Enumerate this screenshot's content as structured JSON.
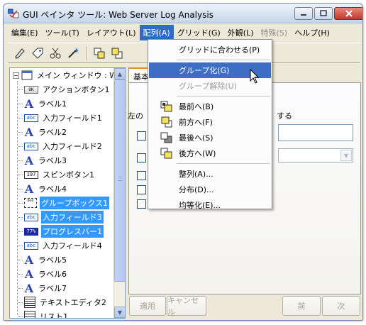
{
  "window": {
    "title": "GUI ペインタ ツール: Web Server Log Analysis"
  },
  "menubar": [
    {
      "label": "編集(E)",
      "active": false,
      "disabled": false
    },
    {
      "label": "ツール(T)",
      "active": false,
      "disabled": false
    },
    {
      "label": "レイアウト(L)",
      "active": false,
      "disabled": false
    },
    {
      "label": "配列(A)",
      "active": true,
      "disabled": false
    },
    {
      "label": "グリッド(G)",
      "active": false,
      "disabled": false
    },
    {
      "label": "外観(L)",
      "active": false,
      "disabled": false
    },
    {
      "label": "特殊(S)",
      "active": false,
      "disabled": true
    },
    {
      "label": "ヘルプ(H)",
      "active": false,
      "disabled": false
    }
  ],
  "toolbar": {
    "icons": [
      "pointer-tool-icon",
      "tag-tool-icon",
      "cut-tool-icon",
      "wand-tool-icon",
      "bring-front-icon",
      "bring-forward-icon"
    ]
  },
  "tree": {
    "root_label": "メイン ウィンドウ : W",
    "items": [
      {
        "label": "アクションボタン1",
        "icon": "button-icon",
        "icon_text": "OK",
        "selected": false
      },
      {
        "label": "ラベル1",
        "icon": "label-icon",
        "icon_text": "A",
        "selected": false
      },
      {
        "label": "入力フィールド1",
        "icon": "input-field-icon",
        "icon_text": "abc",
        "selected": false
      },
      {
        "label": "ラベル2",
        "icon": "label-icon",
        "icon_text": "A",
        "selected": false
      },
      {
        "label": "入力フィールド2",
        "icon": "input-field-icon",
        "icon_text": "abc",
        "selected": false
      },
      {
        "label": "ラベル3",
        "icon": "label-icon",
        "icon_text": "A",
        "selected": false
      },
      {
        "label": "スピンボタン1",
        "icon": "spin-button-icon",
        "icon_text": "197",
        "selected": false
      },
      {
        "label": "ラベル4",
        "icon": "label-icon",
        "icon_text": "A",
        "selected": false
      },
      {
        "label": "グループボックス1",
        "icon": "group-box-icon",
        "icon_text": "box",
        "selected": true
      },
      {
        "label": "入力フィールド3",
        "icon": "input-field-icon",
        "icon_text": "abc",
        "selected": true
      },
      {
        "label": "プログレスバー1",
        "icon": "progress-bar-icon",
        "icon_text": "77%",
        "selected": true
      },
      {
        "label": "入力フィールド4",
        "icon": "input-field-icon",
        "icon_text": "abc",
        "selected": false
      },
      {
        "label": "ラベル5",
        "icon": "label-icon",
        "icon_text": "A",
        "selected": false
      },
      {
        "label": "ラベル6",
        "icon": "label-icon",
        "icon_text": "A",
        "selected": false
      },
      {
        "label": "ラベル7",
        "icon": "label-icon",
        "icon_text": "A",
        "selected": false
      },
      {
        "label": "テキストエディタ2",
        "icon": "text-editor-icon",
        "icon_text": "",
        "selected": false
      },
      {
        "label": "リスト1",
        "icon": "list-icon",
        "icon_text": "",
        "selected": false
      }
    ]
  },
  "panel": {
    "tab_label": "基本",
    "left_label": "左の",
    "right_label": "する",
    "buttons": {
      "apply": "適用",
      "cancel": "キャンセル",
      "prev": "前",
      "next": "次"
    }
  },
  "dropdown": {
    "items": [
      {
        "label": "グリッドに合わせる(P)",
        "icon": "",
        "highlighted": false,
        "disabled": false,
        "sep_after": true
      },
      {
        "label": "グループ化(G)",
        "icon": "",
        "highlighted": true,
        "disabled": false,
        "sep_after": false
      },
      {
        "label": "グループ解除(U)",
        "icon": "",
        "highlighted": false,
        "disabled": true,
        "sep_after": true
      },
      {
        "label": "最前へ(B)",
        "icon": "bring-to-front-icon",
        "highlighted": false,
        "disabled": false,
        "sep_after": false
      },
      {
        "label": "前方へ(F)",
        "icon": "bring-forward-icon",
        "highlighted": false,
        "disabled": false,
        "sep_after": false
      },
      {
        "label": "最後へ(S)",
        "icon": "send-to-back-icon",
        "highlighted": false,
        "disabled": false,
        "sep_after": false
      },
      {
        "label": "後方へ(W)",
        "icon": "send-backward-icon",
        "highlighted": false,
        "disabled": false,
        "sep_after": true
      },
      {
        "label": "整列(A)...",
        "icon": "",
        "highlighted": false,
        "disabled": false,
        "sep_after": false
      },
      {
        "label": "分布(D)...",
        "icon": "",
        "highlighted": false,
        "disabled": false,
        "sep_after": false
      },
      {
        "label": "均等化(E)...",
        "icon": "",
        "highlighted": false,
        "disabled": false,
        "sep_after": false
      }
    ]
  },
  "colors": {
    "selection": "#3399ff",
    "menu_highlight": "#3d6ec4",
    "menu_active": "#316ac5",
    "window_bg": "#ece9d8"
  }
}
